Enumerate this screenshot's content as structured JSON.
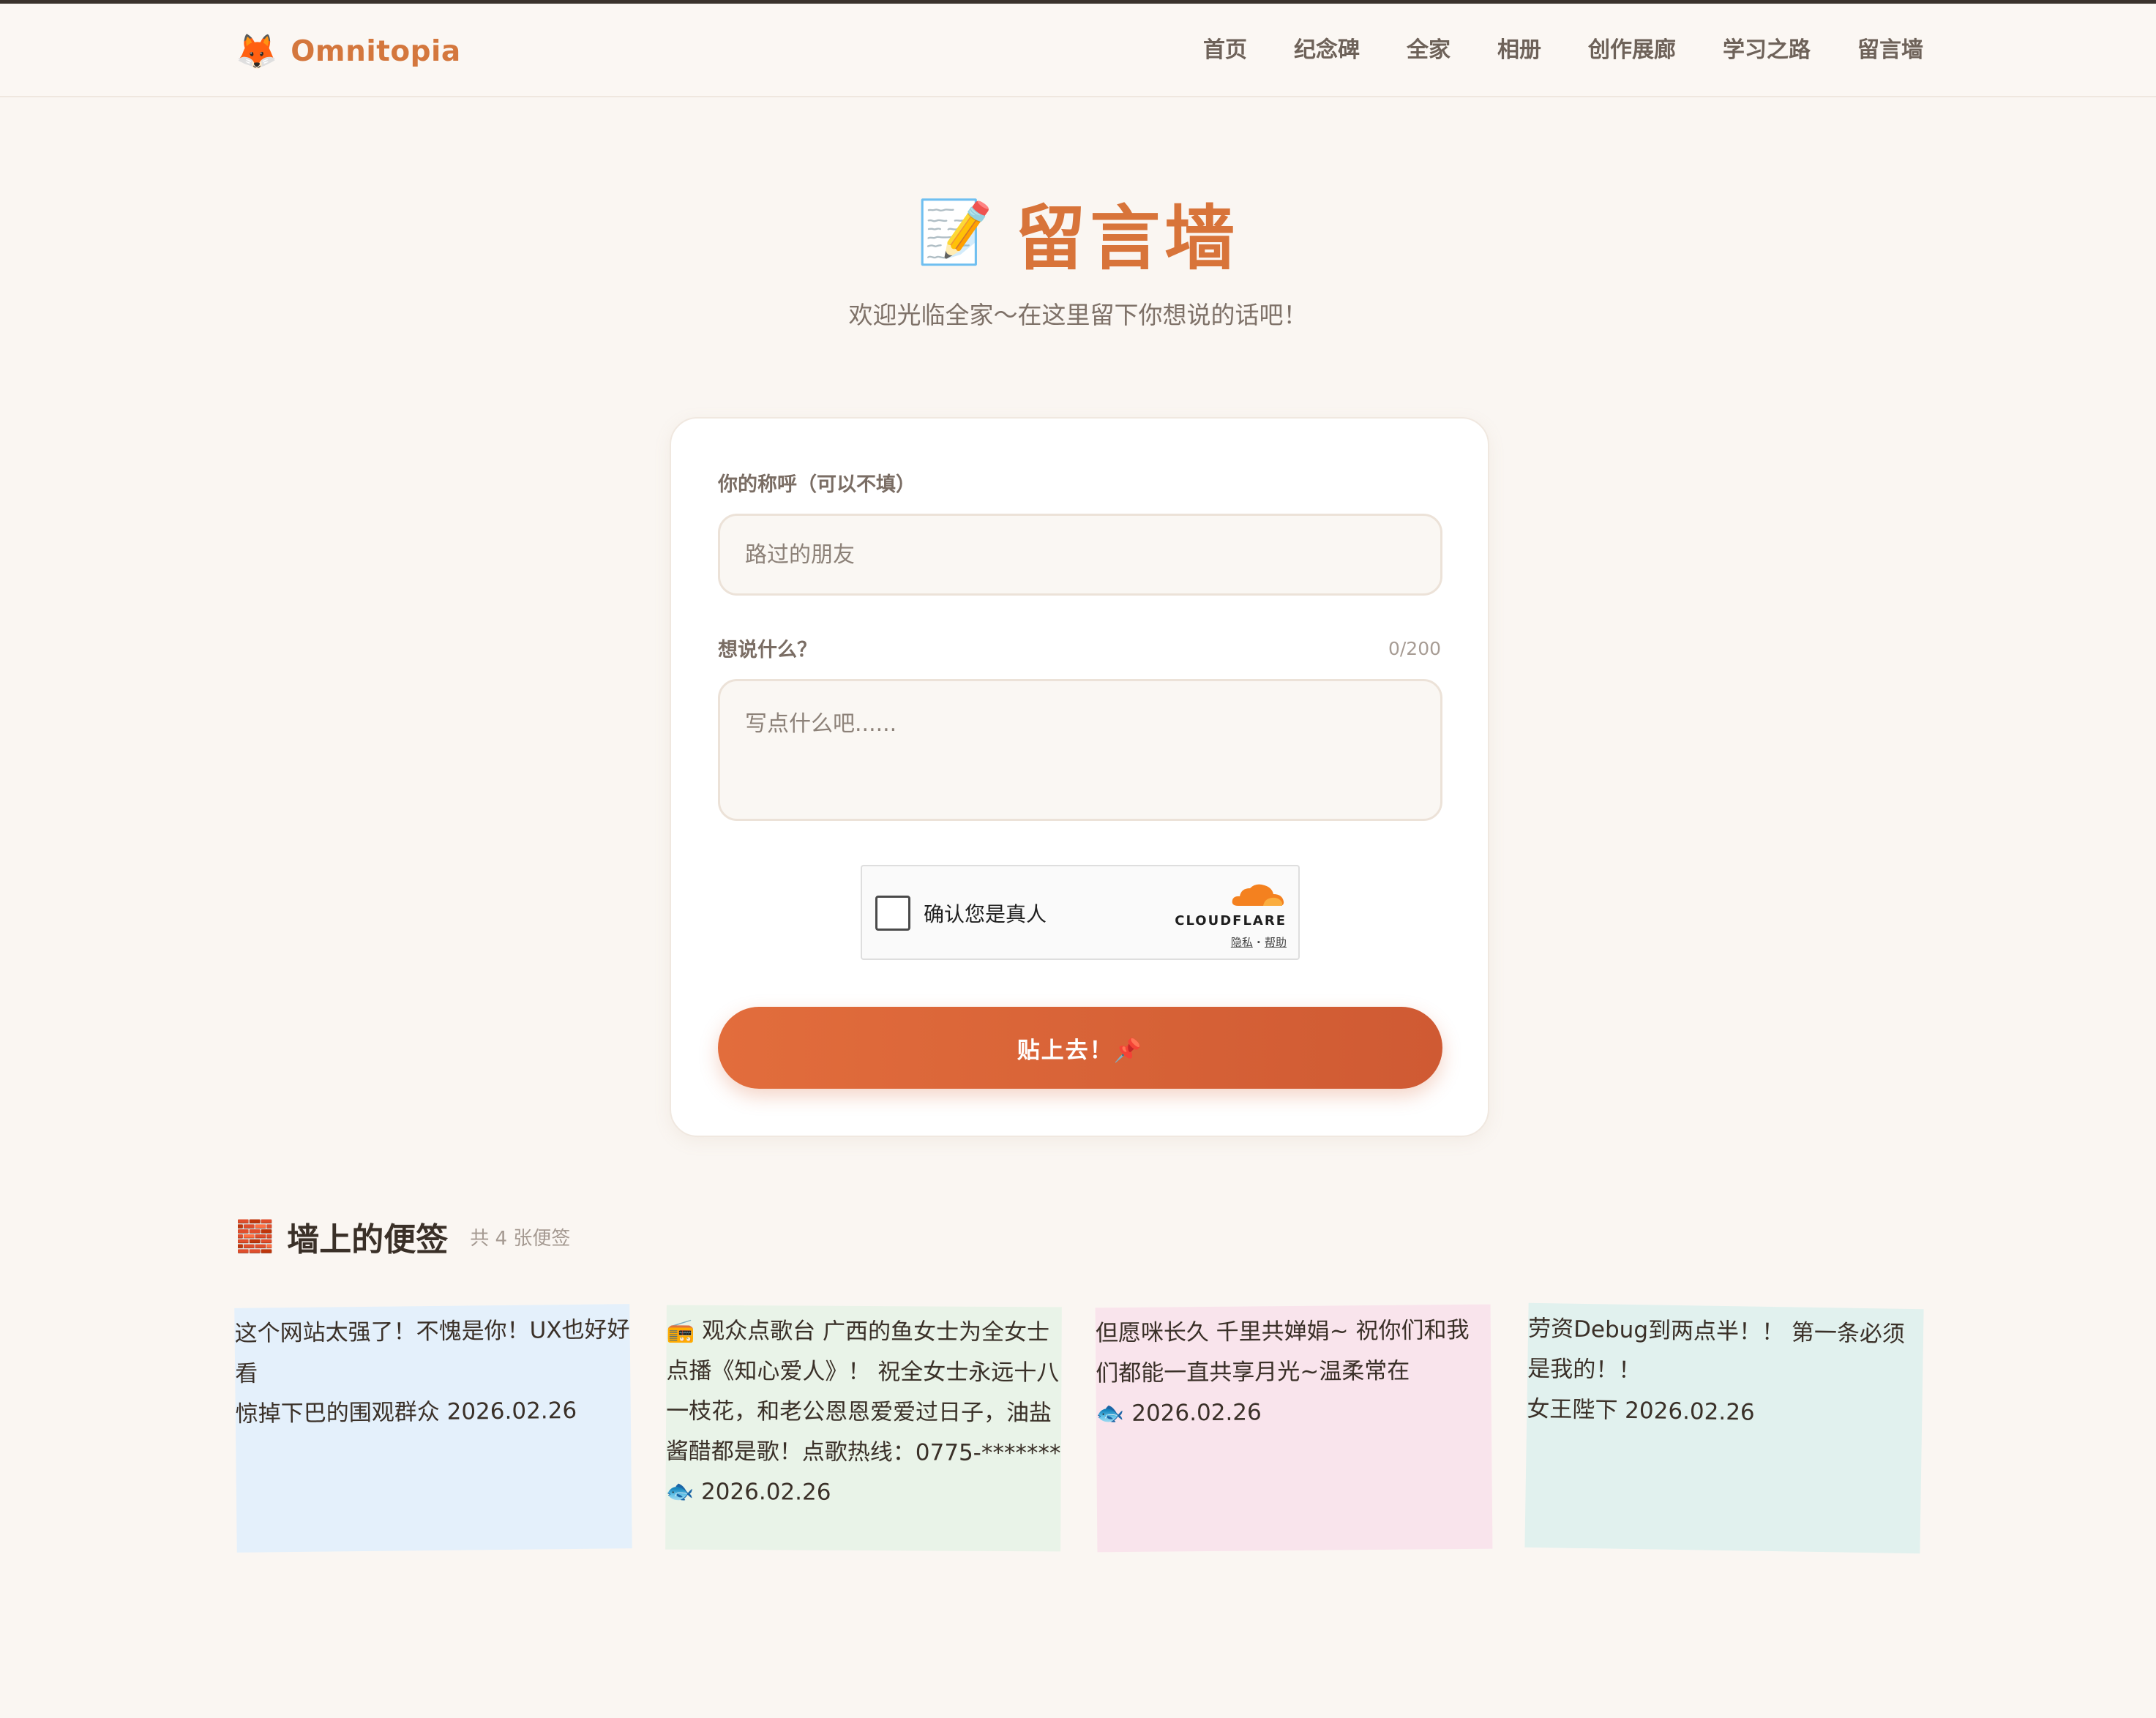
{
  "header": {
    "logo_icon": "🦊",
    "logo_text": "Omnitopia",
    "nav": [
      "首页",
      "纪念碑",
      "全家",
      "相册",
      "创作展廊",
      "学习之路",
      "留言墙"
    ]
  },
  "hero": {
    "icon": "📝",
    "title": "留言墙",
    "subtitle": "欢迎光临全家～在这里留下你想说的话吧！"
  },
  "form": {
    "name_label": "你的称呼（可以不填）",
    "name_placeholder": "路过的朋友",
    "message_label": "想说什么？",
    "counter": "0/200",
    "message_placeholder": "写点什么吧......",
    "captcha_text": "确认您是真人",
    "captcha_brand": "CLOUDFLARE",
    "captcha_privacy": "隐私",
    "captcha_sep": " · ",
    "captcha_help": "帮助",
    "submit_label": "贴上去！📌"
  },
  "wall": {
    "icon": "🧱",
    "title": "墙上的便签",
    "count": "共 4 张便签",
    "notes": [
      {
        "message": "这个网站太强了！不愧是你！UX也好好看",
        "meta": "惊掉下巴的围观群众 2026.02.26"
      },
      {
        "message": "📻 观众点歌台 广西的鱼女士为全女士点播《知心爱人》！ 祝全女士永远十八一枝花，和老公恩恩爱爱过日子，油盐酱醋都是歌！点歌热线：0775-*******",
        "meta": "🐟 2026.02.26"
      },
      {
        "message": "但愿咪长久 千里共婵娟~ 祝你们和我们都能一直共享月光~温柔常在",
        "meta": "🐟 2026.02.26"
      },
      {
        "message": "劳资Debug到两点半！！ 第一条必须是我的！！",
        "meta": "女王陛下 2026.02.26"
      }
    ]
  },
  "colors": {
    "accent": "#d8743a",
    "button": "#e26d3c",
    "background": "#faf6f2"
  }
}
